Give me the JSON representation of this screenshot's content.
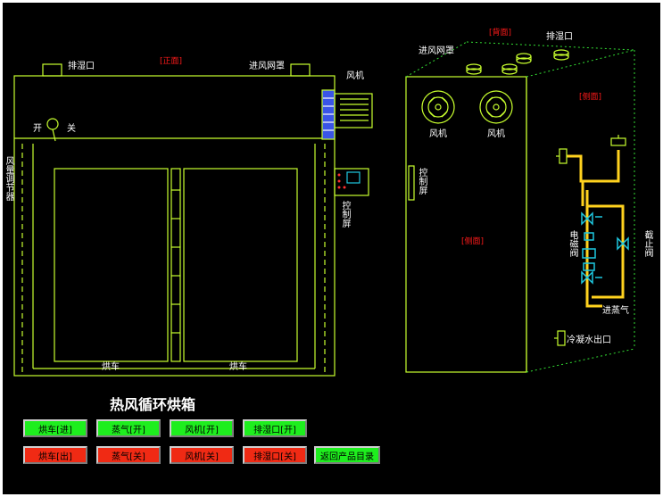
{
  "colors": {
    "line": "#c8ff2e",
    "dotted": "#33dd33",
    "pipe": "#ffd21e",
    "valve": "#1ec8e0",
    "green_btn": "#1eee1e",
    "red_btn": "#f02a14"
  },
  "title": "热风循环烘箱",
  "front": {
    "view_label": "[正面]",
    "exhaust_label": "排湿口",
    "air_inlet_label": "进风网罩",
    "fan_label": "风机",
    "on_label": "开",
    "off_label": "关",
    "damper_label": "风量调节器",
    "control_screen_label": "控制屏",
    "cart_left_label": "烘车",
    "cart_right_label": "烘车"
  },
  "side": {
    "back_label": "[背面]",
    "side_label": "[侧面]",
    "side2_label": "[侧面]",
    "air_inlet_label": "进风网罩",
    "exhaust_label": "排湿口",
    "fan1_label": "风机",
    "fan2_label": "风机",
    "control_screen_label": "控制屏",
    "solenoid_label": "电磁阀",
    "stop_valve_label": "截止阀",
    "steam_in_label": "进蒸气",
    "condensate_label": "冷凝水出口"
  },
  "buttons": {
    "cart_in": "烘车[进]",
    "steam_on": "蒸气[开]",
    "fan_on": "风机[开]",
    "exhaust_on": "排湿口[开]",
    "cart_out": "烘车[出]",
    "steam_off": "蒸气[关]",
    "fan_off": "风机[关]",
    "exhaust_off": "排湿口[关]",
    "back_catalog": "返回产品目录"
  }
}
